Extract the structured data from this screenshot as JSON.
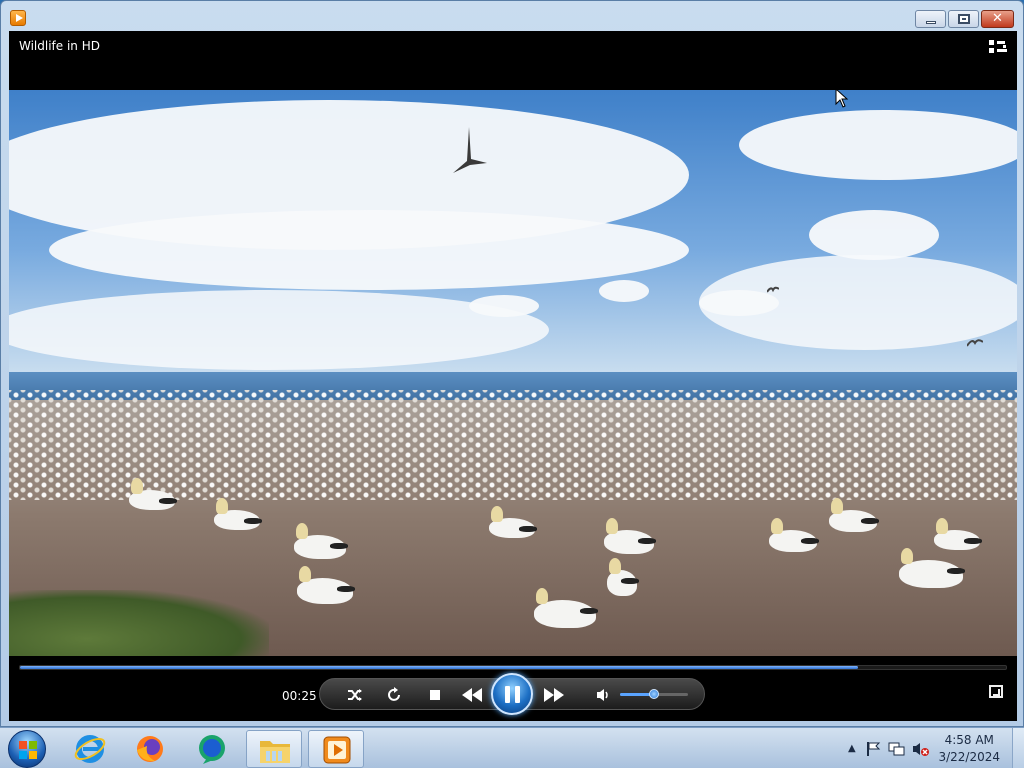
{
  "window": {
    "title": "Wildlife in HD",
    "caption_buttons": {
      "minimize": "minimize",
      "maximize": "restore",
      "close": "✕"
    },
    "icons": [
      "media-player-icon",
      "switch-to-library-icon"
    ]
  },
  "player": {
    "elapsed": "00:25",
    "progress_fraction": 0.85,
    "volume_fraction": 0.5,
    "state": "playing",
    "controls": [
      "shuffle",
      "repeat",
      "stop",
      "previous",
      "pause",
      "next",
      "mute",
      "volume",
      "full-screen"
    ]
  },
  "taskbar": {
    "pinned": [
      "start",
      "internet-explorer",
      "firefox",
      "chat",
      "file-explorer",
      "media-player"
    ],
    "active": "media-player",
    "tray": {
      "time": "4:58 AM",
      "date": "3/22/2024",
      "icons": [
        "show-hidden-icons",
        "action-center-flag",
        "network",
        "volume-muted"
      ]
    }
  },
  "colors": {
    "seek_fill": "#2e6fd0",
    "taskbar": "#a9c1dd",
    "video_bg": "#000000"
  }
}
